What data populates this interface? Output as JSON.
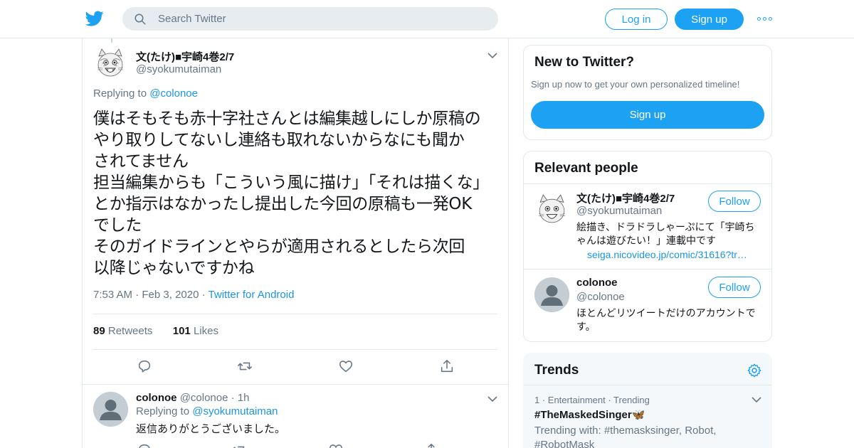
{
  "header": {
    "search_placeholder": "Search Twitter",
    "login_label": "Log in",
    "signup_label": "Sign up",
    "brand_color": "#1da1f2"
  },
  "tweet": {
    "author_name": "文(たけ)■宇崎4巻2/7",
    "author_handle": "@syokumutaiman",
    "replying_prefix": "Replying to",
    "replying_to": "@colonoe",
    "text": "僕はそもそも赤十字社さんとは編集越しにしか原稿の\nやり取りしてないし連絡も取れないからなにも聞か\nされてません\n担当編集からも「こういう風に描け」「それは描くな」\nとか指示はなかったし提出した今回の原稿も一発OK\nでした\nそのガイドラインとやらが適用されるとしたら次回\n以降じゃないですかね",
    "time": "7:53 AM",
    "date": "Feb 3, 2020",
    "source": "Twitter for Android",
    "retweet_count": "89",
    "retweets_label": "Retweets",
    "like_count": "101",
    "likes_label": "Likes"
  },
  "reply": {
    "name": "colonoe",
    "handle": "@colonoe",
    "time": "1h",
    "replying_prefix": "Replying to",
    "replying_to": "@syokumutaiman",
    "text": "返信ありがとうございました。"
  },
  "sidebar": {
    "new_to_twitter": {
      "title": "New to Twitter?",
      "subtitle": "Sign up now to get your own personalized timeline!",
      "signup_label": "Sign up"
    },
    "relevant_people": {
      "title": "Relevant people",
      "people": [
        {
          "name": "文(たけ)■宇崎4巻2/7",
          "handle": "@syokumutaiman",
          "follow_label": "Follow",
          "bio": "絵描き、ドラドラしゃーぷにて「宇崎ちゃんは遊びたい！」連載中です",
          "link": "seiga.nicovideo.jp/comic/31616?tr…"
        },
        {
          "name": "colonoe",
          "handle": "@colonoe",
          "follow_label": "Follow",
          "bio": "ほとんどリツイートだけのアカウントです。"
        }
      ]
    },
    "trends": {
      "title": "Trends",
      "items": [
        {
          "meta": "1 · Entertainment · Trending",
          "name": "#TheMaskedSinger🦋",
          "with": "Trending with: #themasksinger, Robot, #RobotMask"
        }
      ]
    }
  },
  "icons": {
    "logo": "twitter-bird-icon",
    "search": "search-icon",
    "more": "more-dots-icon",
    "chevron": "chevron-down-icon",
    "reply": "reply-icon",
    "retweet": "retweet-icon",
    "like": "heart-icon",
    "share": "share-icon",
    "gear": "gear-icon"
  }
}
